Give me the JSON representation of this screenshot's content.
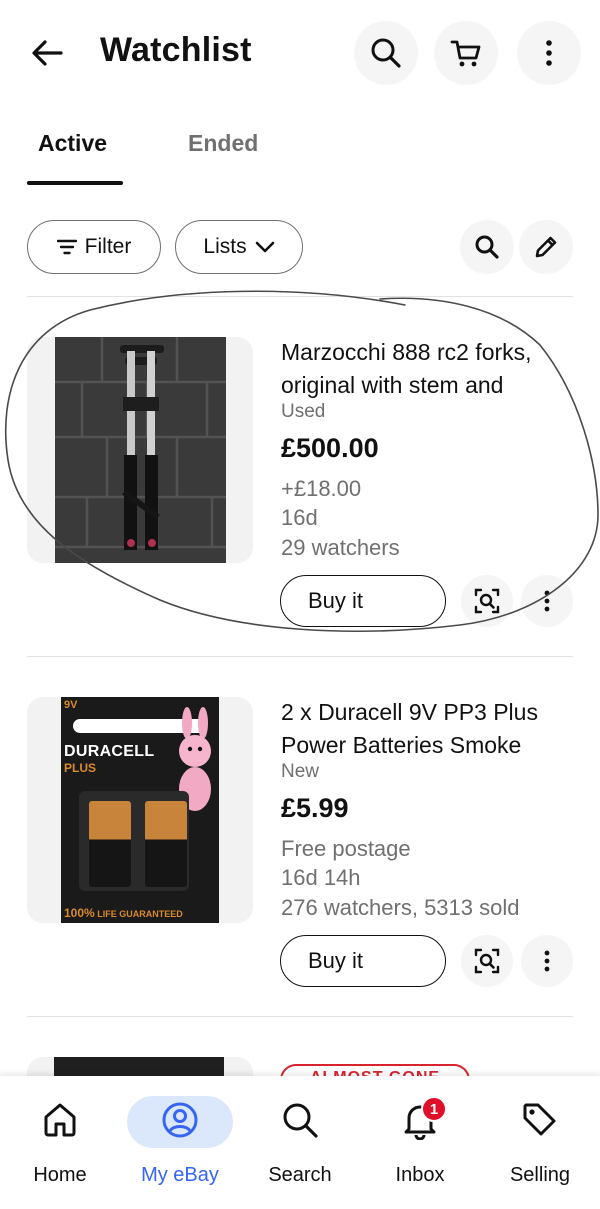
{
  "header": {
    "title": "Watchlist"
  },
  "tabs": [
    {
      "label": "Active",
      "active": true
    },
    {
      "label": "Ended",
      "active": false
    }
  ],
  "toolbar": {
    "filter_label": "Filter",
    "lists_label": "Lists"
  },
  "items": [
    {
      "title_line1": "Marzocchi 888 rc2 forks,",
      "title_line2": "original with stem and",
      "condition": "Used",
      "price": "£500.00",
      "postage": "+£18.00",
      "time_left": "16d",
      "watchers": "29 watchers",
      "buy_label": "Buy it"
    },
    {
      "title_line1": "2 x Duracell 9V PP3 Plus",
      "title_line2": "Power Batteries Smoke",
      "condition": "New",
      "price": "£5.99",
      "postage": "Free postage",
      "time_left": "16d 14h",
      "watchers": "276 watchers, 5313 sold",
      "buy_label": "Buy it",
      "package": {
        "voltage": "9V",
        "brand": "DURACELL",
        "line": "PLUS",
        "guarantee_pct": "100%",
        "guarantee_text": "LIFE GUARANTEED"
      }
    }
  ],
  "peek_badge": "ALMOST GONE",
  "bottom_nav": [
    {
      "label": "Home",
      "icon": "home-icon"
    },
    {
      "label": "My eBay",
      "icon": "user-icon",
      "active": true
    },
    {
      "label": "Search",
      "icon": "search-icon"
    },
    {
      "label": "Inbox",
      "icon": "bell-icon",
      "badge": "1"
    },
    {
      "label": "Selling",
      "icon": "tag-icon"
    }
  ],
  "colors": {
    "accent": "#3665f3",
    "active_nav_bg": "#dbe8fb",
    "badge": "#e0102b",
    "text": "#111111",
    "muted": "#707070"
  }
}
